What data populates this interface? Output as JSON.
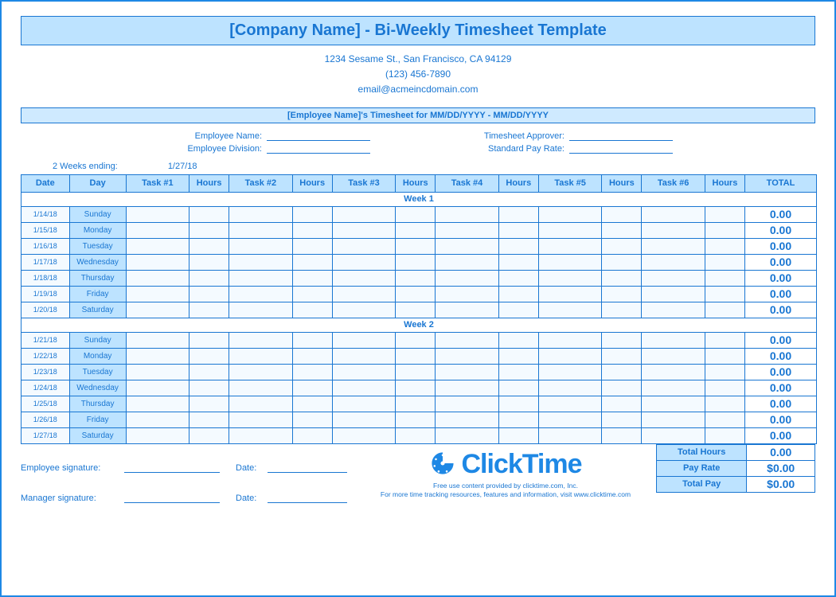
{
  "title": "[Company Name] - Bi-Weekly Timesheet Template",
  "company": {
    "address": "1234 Sesame St.,  San Francisco, CA 94129",
    "phone": "(123) 456-7890",
    "email": "email@acmeincdomain.com"
  },
  "subtitle": "[Employee Name]'s Timesheet for MM/DD/YYYY - MM/DD/YYYY",
  "fields": {
    "emp_name_label": "Employee Name:",
    "emp_div_label": "Employee Division:",
    "approver_label": "Timesheet Approver:",
    "pay_rate_label": "Standard Pay Rate:"
  },
  "weeks_ending_label": "2 Weeks ending:",
  "weeks_ending_value": "1/27/18",
  "headers": {
    "date": "Date",
    "day": "Day",
    "task1": "Task #1",
    "task2": "Task #2",
    "task3": "Task #3",
    "task4": "Task #4",
    "task5": "Task #5",
    "task6": "Task #6",
    "hours": "Hours",
    "total": "TOTAL"
  },
  "week1_label": "Week 1",
  "week2_label": "Week 2",
  "week1": [
    {
      "date": "1/14/18",
      "day": "Sunday",
      "total": "0.00"
    },
    {
      "date": "1/15/18",
      "day": "Monday",
      "total": "0.00"
    },
    {
      "date": "1/16/18",
      "day": "Tuesday",
      "total": "0.00"
    },
    {
      "date": "1/17/18",
      "day": "Wednesday",
      "total": "0.00"
    },
    {
      "date": "1/18/18",
      "day": "Thursday",
      "total": "0.00"
    },
    {
      "date": "1/19/18",
      "day": "Friday",
      "total": "0.00"
    },
    {
      "date": "1/20/18",
      "day": "Saturday",
      "total": "0.00"
    }
  ],
  "week2": [
    {
      "date": "1/21/18",
      "day": "Sunday",
      "total": "0.00"
    },
    {
      "date": "1/22/18",
      "day": "Monday",
      "total": "0.00"
    },
    {
      "date": "1/23/18",
      "day": "Tuesday",
      "total": "0.00"
    },
    {
      "date": "1/24/18",
      "day": "Wednesday",
      "total": "0.00"
    },
    {
      "date": "1/25/18",
      "day": "Thursday",
      "total": "0.00"
    },
    {
      "date": "1/26/18",
      "day": "Friday",
      "total": "0.00"
    },
    {
      "date": "1/27/18",
      "day": "Saturday",
      "total": "0.00"
    }
  ],
  "totals": {
    "total_hours_label": "Total Hours",
    "total_hours_value": "0.00",
    "pay_rate_label": "Pay Rate",
    "pay_rate_value": "$0.00",
    "total_pay_label": "Total Pay",
    "total_pay_value": "$0.00"
  },
  "signatures": {
    "emp_sig_label": "Employee signature:",
    "mgr_sig_label": "Manager signature:",
    "date_label": "Date:"
  },
  "logo_text": "ClickTime",
  "footnote1": "Free use content provided by clicktime.com, Inc.",
  "footnote2": "For more time tracking resources, features and information, visit www.clicktime.com"
}
